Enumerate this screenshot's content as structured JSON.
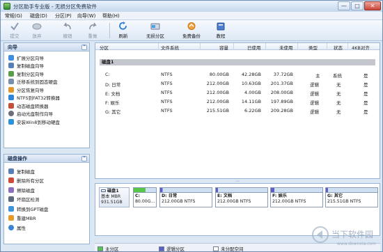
{
  "window": {
    "title": "分区助手专业版 - 无损分区免费软件",
    "close_glyph": "✕",
    "max_glyph": "□",
    "min_glyph": "—"
  },
  "menu": [
    "常规(G)",
    "磁盘(D)",
    "分区(P)",
    "向导(W)",
    "帮助(H)"
  ],
  "toolbar": {
    "submit": "提交",
    "discard": "放弃",
    "undo": "撤销",
    "redo": "重做",
    "refresh": "刷新",
    "lossless": "无损分区",
    "backup": "免费备份",
    "tutorial": "教程"
  },
  "wizard": {
    "title": "向导",
    "items": [
      "扩展分区向导",
      "复制磁盘向导",
      "复制分区向导",
      "迁移系统到固态硬盘",
      "分区恢复向导",
      "NTFS到FAT32转换器",
      "动态磁盘转换器",
      "启动光盘制作向导",
      "安装Win8到移动硬盘"
    ]
  },
  "disk_ops": {
    "title": "磁盘操作",
    "items": [
      "复制磁盘",
      "删除所有分区",
      "擦除磁盘",
      "坏扇区检测",
      "转换到GPT磁盘",
      "重建MBR",
      "属性"
    ]
  },
  "table": {
    "headers": [
      "分区",
      "文件系统",
      "容量",
      "已使用",
      "未使用",
      "类型",
      "状态",
      "4KB对齐"
    ],
    "disk_label": "磁盘1",
    "rows": [
      {
        "part": "C:",
        "fs": "NTFS",
        "cap": "80.00GB",
        "used": "42.28GB",
        "free": "37.72GB",
        "type": "主",
        "status": "系统",
        "align": "是"
      },
      {
        "part": "D: 日常",
        "fs": "NTFS",
        "cap": "212.00GB",
        "used": "10.63GB",
        "free": "201.37GB",
        "type": "逻辑",
        "status": "无",
        "align": "是"
      },
      {
        "part": "E: 文档",
        "fs": "NTFS",
        "cap": "212.00GB",
        "used": "4.00GB",
        "free": "208.00GB",
        "type": "逻辑",
        "status": "无",
        "align": "是"
      },
      {
        "part": "F: 娱乐",
        "fs": "NTFS",
        "cap": "212.00GB",
        "used": "14.11GB",
        "free": "197.89GB",
        "type": "逻辑",
        "status": "无",
        "align": "是"
      },
      {
        "part": "G: 其它",
        "fs": "NTFS",
        "cap": "215.51GB",
        "used": "6.22GB",
        "free": "209.28GB",
        "type": "逻辑",
        "status": "无",
        "align": "是"
      }
    ]
  },
  "diskmap": {
    "name": "磁盘1",
    "kind": "基本 MBR",
    "size": "931.51GB",
    "segments": [
      {
        "label": "C:",
        "info": "80.00G...",
        "fill": 0.53,
        "color": "#57c747"
      },
      {
        "label": "D: 日常",
        "info": "212.00GB NTFS",
        "fill": 0.05,
        "color": "#5b5fc7"
      },
      {
        "label": "E: 文档",
        "info": "212.00GB NTFS",
        "fill": 0.02,
        "color": "#5b5fc7"
      },
      {
        "label": "F: 娱乐",
        "info": "212.00GB NTFS",
        "fill": 0.07,
        "color": "#5b5fc7"
      },
      {
        "label": "G: 其它",
        "info": "215.51GB NTFS",
        "fill": 0.03,
        "color": "#5b5fc7"
      }
    ]
  },
  "legend": {
    "primary": "主分区",
    "logical": "逻辑分区",
    "unalloc": "未分配空间"
  },
  "watermark": {
    "brand": "当下软件园",
    "url": "www.downxia.com"
  }
}
